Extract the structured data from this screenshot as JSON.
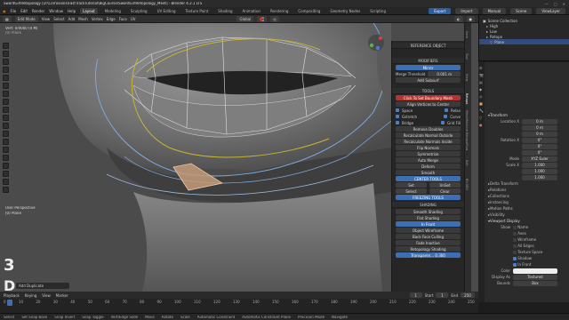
{
  "window": {
    "title": "SwordGirlRetopology [D:\\Corrosions\\FastTrackTutorial\\BigCourse\\SwordGirlRetopology_Meet] - Blender 4.2.1 LTS"
  },
  "menu": [
    "File",
    "Edit",
    "Render",
    "Window",
    "Help"
  ],
  "workspaces": [
    "Layout",
    "Modeling",
    "Sculpting",
    "UV Editing",
    "Texture Paint",
    "Shading",
    "Animation",
    "Rendering",
    "Compositing",
    "Geometry Nodes",
    "Scripting"
  ],
  "topright": {
    "export": "Export",
    "import": "Import",
    "manual": "Manual",
    "scene": "Scene",
    "viewlayer": "ViewLayer"
  },
  "vpheader": {
    "mode": "Edit Mode",
    "items": [
      "View",
      "Select",
      "Add",
      "Mesh",
      "Vertex",
      "Edge",
      "Face",
      "UV"
    ],
    "transform": "Global"
  },
  "viewport": {
    "info1": "Vert: 0/0000 (4 M)",
    "info2": "(0) Plane",
    "persp": "User Perspective",
    "object": "(0) Plane"
  },
  "toolpanel": {
    "ref_title": "REFERENCE OBJECT",
    "modifiers_title": "MODIFIERS",
    "mirror": "Mirror",
    "merge": "Merge Threshold",
    "merge_val": "0.001 m",
    "subsurf": "Add Subsurf",
    "tools_title": "TOOLS",
    "boundary": "Click To Set Boundary Mesh",
    "align": "Align Vertices to Center",
    "chk1": "Space",
    "chk2": "Relax",
    "chk3": "Gstretch",
    "chk4": "Curve",
    "chk5": "Bridge",
    "chk6": "Grid Fill",
    "remove": "Remove Doubles",
    "recalc_out": "Recalculate Normal Outside",
    "recalc_in": "Recalculate Normals Inside",
    "flip": "Flip Normals",
    "symmetrize": "Symmetrize",
    "auto": "Auto Merge",
    "deform": "Deform",
    "smooth": "Smooth",
    "center_title": "CENTER TOOLS",
    "set": "Set",
    "unset": "UnSet",
    "select": "Select",
    "clear": "Clear",
    "freezing": "FREEZING TOOLS",
    "shading_title": "SHADING",
    "sh1": "Smooth Shading",
    "sh2": "Flat Shading",
    "sh3": "In Front",
    "sh4": "Object Wireframe",
    "sh5": "Back Face Culling",
    "sh6": "Fade Inactive",
    "sh7": "Retopology Shading",
    "transp": "Transparen... 0.300"
  },
  "sidetabs": [
    "Item",
    "Tool",
    "View",
    "Retopo",
    "MeshMachine",
    "RetopoFlow",
    "Edit",
    "BY-GEN"
  ],
  "outliner": {
    "title": "Scene Collection",
    "rows": [
      "High",
      "Low",
      "Retopo",
      "Plane"
    ]
  },
  "props": {
    "transform": "Transform",
    "location": "Location X",
    "loc_vals": [
      "0 m",
      "0 m",
      "0 m"
    ],
    "rotation": "Rotation X",
    "rot_vals": [
      "0°",
      "0°",
      "0°"
    ],
    "mode": "Mode",
    "mode_val": "XYZ Euler",
    "scale": "Scale X",
    "scale_vals": [
      "1.000",
      "1.000",
      "1.000"
    ],
    "sections": [
      "Delta Transform",
      "Relations",
      "Collections",
      "Instancing",
      "Motion Paths",
      "Visibility",
      "Viewport Display"
    ],
    "show": "Show",
    "show_items": [
      "Name",
      "Axes",
      "Wireframe",
      "All Edges",
      "Texture Space",
      "Shadow",
      "In Front"
    ],
    "color": "Color",
    "display_as": "Display As",
    "display_val": "Textured",
    "bounds": "Bounds",
    "bounds_val": "Box"
  },
  "timeline": {
    "items": [
      "Playback",
      "Keying",
      "View",
      "Marker"
    ],
    "start": "Start",
    "start_val": "1",
    "end": "End",
    "end_val": "250",
    "frame": "1",
    "ticks": [
      "0",
      "10",
      "20",
      "30",
      "40",
      "50",
      "60",
      "70",
      "80",
      "90",
      "100",
      "110",
      "120",
      "130",
      "140",
      "150",
      "160",
      "170",
      "180",
      "190",
      "200",
      "210",
      "220",
      "230",
      "240",
      "250"
    ]
  },
  "addpanel": "Add Duplicate",
  "status": [
    "Select",
    "Set Snap Base",
    "Snap Invert",
    "Snap Toggle",
    "Vert/Edge Slide",
    "Move",
    "Rotate",
    "Scale",
    "Automatic Constraint",
    "Automatic Constraint Plane",
    "Precision Mode",
    "Navigate"
  ],
  "overlay": {
    "n3": "3",
    "nD": "D"
  }
}
